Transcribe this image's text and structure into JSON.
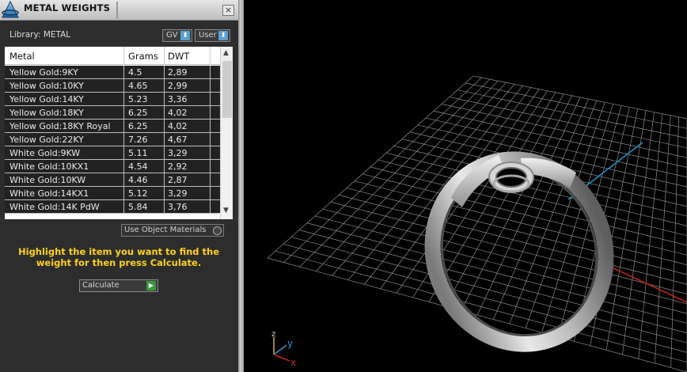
{
  "panel": {
    "title": "METAL WEIGHTS",
    "close_glyph": "×",
    "library_label": "Library: METAL",
    "gv_dropdown": "GV",
    "user_dropdown": "User",
    "dropdown_glyph": "⬍",
    "table": {
      "headers": [
        "Metal",
        "Grams",
        "DWT"
      ],
      "rows": [
        [
          "Yellow Gold:9KY",
          "4.5",
          "2,89"
        ],
        [
          "Yellow Gold:10KY",
          "4.65",
          "2,99"
        ],
        [
          "Yellow Gold:14KY",
          "5.23",
          "3,36"
        ],
        [
          "Yellow Gold:18KY",
          "6.25",
          "4,02"
        ],
        [
          "Yellow Gold:18KY Royal",
          "6.25",
          "4,02"
        ],
        [
          "Yellow Gold:22KY",
          "7.26",
          "4,67"
        ],
        [
          "White Gold:9KW",
          "5.11",
          "3,29"
        ],
        [
          "White Gold:10KX1",
          "4.54",
          "2,92"
        ],
        [
          "White Gold:10KW",
          "4.46",
          "2,87"
        ],
        [
          "White Gold:14KX1",
          "5.12",
          "3,29"
        ],
        [
          "White Gold:14K PdW",
          "5.84",
          "3,76"
        ]
      ]
    },
    "use_object_materials": "Use Object Materials",
    "instruction": "Highlight the item you want to find the weight for then press Calculate.",
    "calculate": "Calculate",
    "calculate_glyph": "▶"
  },
  "viewport": {
    "axis_labels": {
      "z": "z",
      "y": "y",
      "x": "x"
    },
    "colors": {
      "background": "#000000",
      "grid": "#8c8c8c",
      "x_axis": "#c0241e",
      "y_axis": "#1f8fc9"
    },
    "object": "ring"
  }
}
